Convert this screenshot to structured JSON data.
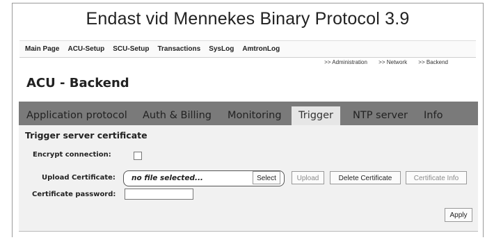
{
  "caption": "Endast vid Mennekes Binary Protocol 3.9",
  "topmenu": [
    "Main Page",
    "ACU-Setup",
    "SCU-Setup",
    "Transactions",
    "SysLog",
    "AmtronLog"
  ],
  "breadcrumb": [
    ">> Administration",
    ">> Network",
    ">> Backend"
  ],
  "page_title": "ACU - Backend",
  "tabs": [
    "Application protocol",
    "Auth & Billing",
    "Monitoring",
    "Trigger",
    "NTP server",
    "Info"
  ],
  "active_tab": "Trigger",
  "section_title": "Trigger server certificate",
  "encrypt_label": "Encrypt connection:",
  "encrypt_checked": false,
  "upload_label": "Upload Certificate:",
  "file_placeholder": "no file selected...",
  "buttons": {
    "select": "Select",
    "upload": "Upload",
    "delete": "Delete Certificate",
    "info": "Certificate Info",
    "apply": "Apply"
  },
  "password_label": "Certificate password:",
  "password_value": ""
}
